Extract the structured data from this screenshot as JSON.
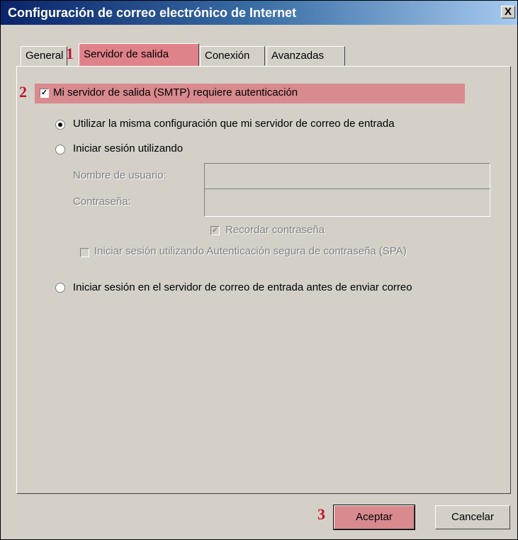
{
  "window": {
    "title": "Configuración de correo electrónico de Internet",
    "close_label": "X"
  },
  "tabs": [
    {
      "label": "General"
    },
    {
      "label": "Servidor de salida"
    },
    {
      "label": "Conexión"
    },
    {
      "label": "Avanzadas"
    }
  ],
  "steps": [
    "1",
    "2",
    "3"
  ],
  "auth": {
    "checkbox_label": "Mi servidor de salida (SMTP) requiere autenticación",
    "checked": true
  },
  "options": {
    "same_config": "Utilizar la misma configuración que mi servidor de correo de entrada",
    "login_using": "Iniciar sesión utilizando",
    "username_label": "Nombre de usuario:",
    "username_value": "",
    "password_label": "Contraseña:",
    "password_value": "",
    "remember_password": "Recordar contraseña",
    "spa_login": "Iniciar sesión utilizando Autenticación segura de contraseña (SPA)",
    "login_before_send": "Iniciar sesión en el servidor de correo de entrada antes de enviar correo"
  },
  "buttons": {
    "accept": "Aceptar",
    "cancel": "Cancelar"
  },
  "colors": {
    "highlight": "#d98a8f",
    "step_number": "#c8102e",
    "titlebar": "#0a246a"
  }
}
